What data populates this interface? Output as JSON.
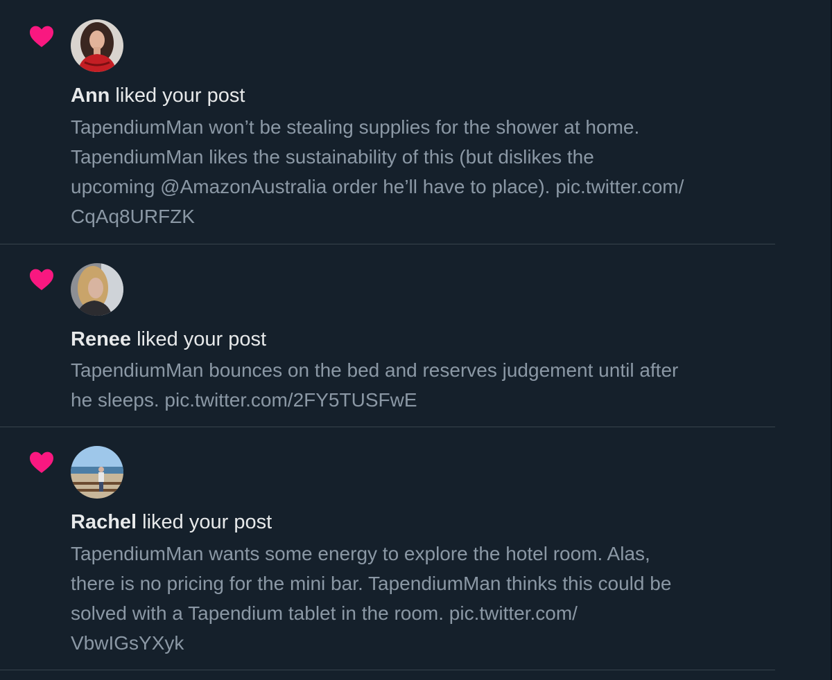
{
  "notifications": [
    {
      "user": "Ann",
      "action": " liked your post",
      "post_lines": [
        "TapendiumMan won’t be stealing supplies for the shower at home.",
        "TapendiumMan likes the sustainability of this (but dislikes the",
        "upcoming @AmazonAustralia order he’ll have to place). pic.twitter.com/",
        "CqAq8URFZK"
      ]
    },
    {
      "user": "Renee",
      "action": " liked your post",
      "post_lines": [
        "TapendiumMan bounces on the bed and reserves judgement until after",
        "he sleeps. pic.twitter.com/2FY5TUSFwE"
      ]
    },
    {
      "user": "Rachel",
      "action": " liked your post",
      "post_lines": [
        "TapendiumMan wants some energy to explore the hotel room. Alas,",
        "there is no pricing for the mini bar.  TapendiumMan thinks this could be",
        "solved with a Tapendium tablet in the room. pic.twitter.com/",
        "VbwIGsYXyk"
      ]
    }
  ],
  "colors": {
    "background": "#15202b",
    "heart": "#f91880",
    "name_text": "#e7e9ea",
    "body_text": "#8b98a5",
    "divider": "#38444d"
  },
  "icons": {
    "like": "heart-icon"
  }
}
